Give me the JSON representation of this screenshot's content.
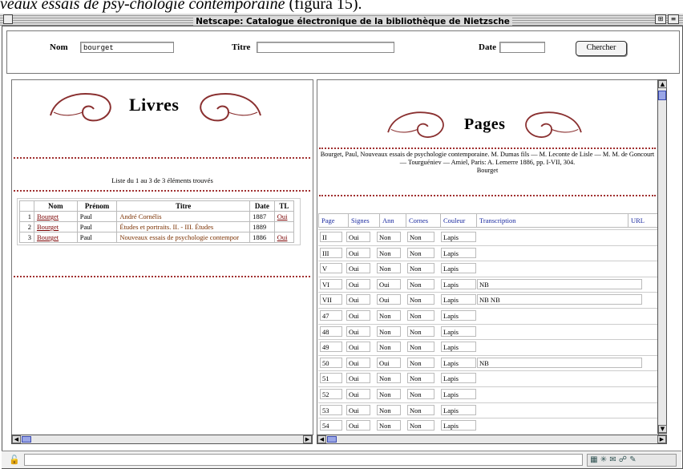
{
  "caption": {
    "text": "veaux essais de psy-chologie contemporaine",
    "suffix": " (figura 15)."
  },
  "window": {
    "title": "Netscape: Catalogue électronique de la bibliothèque de Nietzsche"
  },
  "search": {
    "nom_label": "Nom",
    "nom_value": "bourget",
    "titre_label": "Titre",
    "titre_value": "",
    "date_label": "Date",
    "date_value": "",
    "button_label": "Chercher"
  },
  "left": {
    "heading": "Livres",
    "result_text": "Liste du 1 au 3 de 3 éléments trouvés",
    "columns": [
      "",
      "Nom",
      "Prénom",
      "Titre",
      "Date",
      "TL"
    ],
    "rows": [
      {
        "n": "1",
        "nom": "Bourget",
        "prenom": "Paul",
        "titre": "André Cornélis",
        "date": "1887",
        "tl": "Oui"
      },
      {
        "n": "2",
        "nom": "Bourget",
        "prenom": "Paul",
        "titre": "Études et portraits. II. - III. Études",
        "date": "1889",
        "tl": ""
      },
      {
        "n": "3",
        "nom": "Bourget",
        "prenom": "Paul",
        "titre": "Nouveaux essais de psychologie contempor",
        "date": "1886",
        "tl": "Oui"
      }
    ]
  },
  "right": {
    "heading": "Pages",
    "description": "Bourget, Paul, Nouveaux essais de psychologie contemporaine. M. Dumas fils — M. Leconte de Lisle — M. M. de Goncourt — Tourguéniev — Amiel, Paris: A. Lemerre 1886, pp. I-VII, 304.",
    "author": "Bourget",
    "columns": [
      "Page",
      "Signes",
      "Ann",
      "Cornes",
      "Couleur",
      "Transcription",
      "URL"
    ],
    "rows": [
      {
        "page": "II",
        "signes": "Oui",
        "ann": "Non",
        "cornes": "Non",
        "couleur": "Lapis",
        "trans": ""
      },
      {
        "page": "III",
        "signes": "Oui",
        "ann": "Non",
        "cornes": "Non",
        "couleur": "Lapis",
        "trans": ""
      },
      {
        "page": "V",
        "signes": "Oui",
        "ann": "Non",
        "cornes": "Non",
        "couleur": "Lapis",
        "trans": ""
      },
      {
        "page": "VI",
        "signes": "Oui",
        "ann": "Oui",
        "cornes": "Non",
        "couleur": "Lapis",
        "trans": "NB"
      },
      {
        "page": "VII",
        "signes": "Oui",
        "ann": "Oui",
        "cornes": "Non",
        "couleur": "Lapis",
        "trans": "NB NB"
      },
      {
        "page": "47",
        "signes": "Oui",
        "ann": "Non",
        "cornes": "Non",
        "couleur": "Lapis",
        "trans": ""
      },
      {
        "page": "48",
        "signes": "Oui",
        "ann": "Non",
        "cornes": "Non",
        "couleur": "Lapis",
        "trans": ""
      },
      {
        "page": "49",
        "signes": "Oui",
        "ann": "Non",
        "cornes": "Non",
        "couleur": "Lapis",
        "trans": ""
      },
      {
        "page": "50",
        "signes": "Oui",
        "ann": "Oui",
        "cornes": "Non",
        "couleur": "Lapis",
        "trans": "NB"
      },
      {
        "page": "51",
        "signes": "Oui",
        "ann": "Non",
        "cornes": "Non",
        "couleur": "Lapis",
        "trans": ""
      },
      {
        "page": "52",
        "signes": "Oui",
        "ann": "Non",
        "cornes": "Non",
        "couleur": "Lapis",
        "trans": ""
      },
      {
        "page": "53",
        "signes": "Oui",
        "ann": "Non",
        "cornes": "Non",
        "couleur": "Lapis",
        "trans": ""
      },
      {
        "page": "54",
        "signes": "Oui",
        "ann": "Non",
        "cornes": "Non",
        "couleur": "Lapis",
        "trans": ""
      }
    ]
  },
  "colors": {
    "accent": "#a03030",
    "link": "#7a0000",
    "header_blue": "#1a2aa0",
    "title_text": "#7a3000"
  },
  "icons": [
    "lock-icon",
    "status-icons"
  ]
}
